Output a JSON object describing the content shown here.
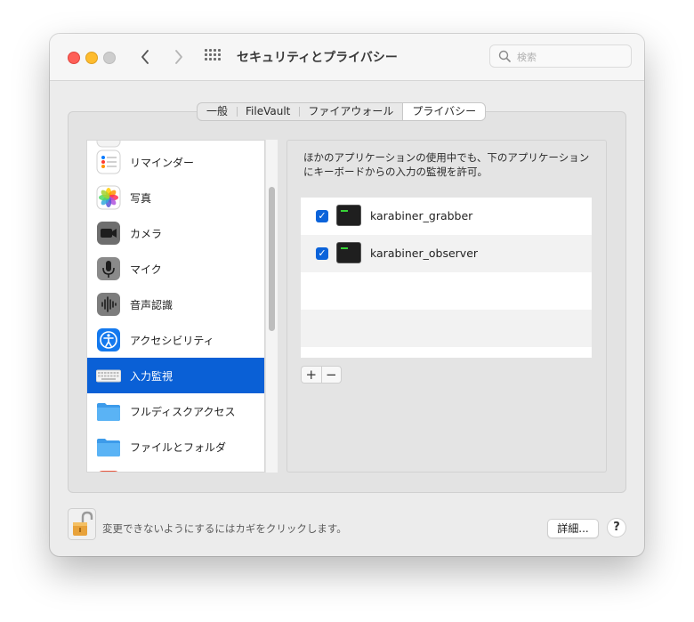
{
  "window": {
    "title": "セキュリティとプライバシー"
  },
  "search": {
    "placeholder": "検索"
  },
  "tabs": [
    {
      "label": "一般",
      "active": false
    },
    {
      "label": "FileVault",
      "active": false
    },
    {
      "label": "ファイアウォール",
      "active": false
    },
    {
      "label": "プライバシー",
      "active": true
    }
  ],
  "sidebar": {
    "items": [
      {
        "label": "リマインダー",
        "icon": "reminders-icon"
      },
      {
        "label": "写真",
        "icon": "photos-icon"
      },
      {
        "label": "カメラ",
        "icon": "camera-icon"
      },
      {
        "label": "マイク",
        "icon": "microphone-icon"
      },
      {
        "label": "音声認識",
        "icon": "speech-recognition-icon"
      },
      {
        "label": "アクセシビリティ",
        "icon": "accessibility-icon"
      },
      {
        "label": "入力監視",
        "icon": "keyboard-icon",
        "selected": true
      },
      {
        "label": "フルディスクアクセス",
        "icon": "folder-icon"
      },
      {
        "label": "ファイルとフォルダ",
        "icon": "folder-icon"
      }
    ]
  },
  "main": {
    "description": "ほかのアプリケーションの使用中でも、下のアプリケーションにキーボードからの入力の監視を許可。",
    "apps": [
      {
        "name": "karabiner_grabber",
        "checked": true,
        "icon": "terminal-icon"
      },
      {
        "name": "karabiner_observer",
        "checked": true,
        "icon": "terminal-icon"
      }
    ],
    "add_label": "+",
    "remove_label": "−"
  },
  "footer": {
    "lock_text": "変更できないようにするにはカギをクリックします。",
    "details_label": "詳細...",
    "help_label": "?"
  },
  "colors": {
    "selection": "#0a60d6",
    "checkbox": "#0b63da",
    "close": "#fe5f57",
    "minimize": "#febc2e"
  }
}
